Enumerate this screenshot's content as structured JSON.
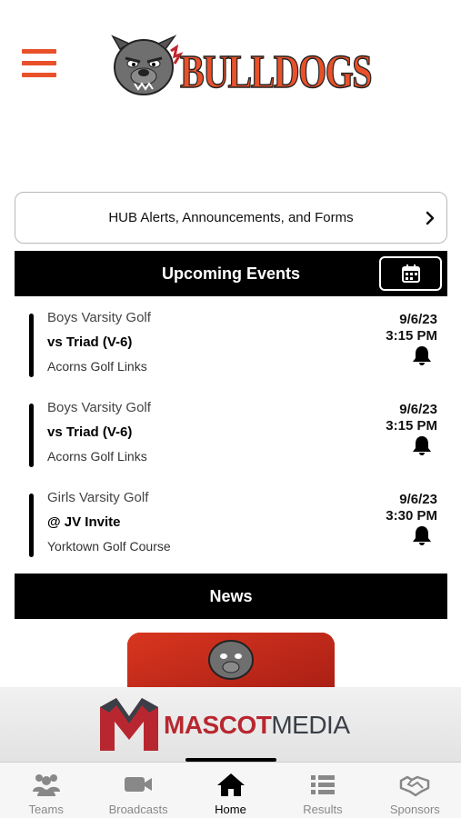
{
  "brand": {
    "accent": "#e8512a",
    "bar": "#000000"
  },
  "header": {
    "logo_text": "BULLDOGS",
    "menu_icon": "hamburger-menu-icon"
  },
  "hub": {
    "label": "HUB Alerts, Announcements, and Forms",
    "icon": "chevron-right-icon"
  },
  "upcoming": {
    "title": "Upcoming Events",
    "calendar_icon": "calendar-icon",
    "events": [
      {
        "team": "Boys Varsity Golf",
        "opponent": "vs Triad (V-6)",
        "venue": "Acorns Golf Links",
        "date": "9/6/23",
        "time": "3:15 PM"
      },
      {
        "team": "Boys Varsity Golf",
        "opponent": "vs Triad (V-6)",
        "venue": "Acorns Golf Links",
        "date": "9/6/23",
        "time": "3:15 PM"
      },
      {
        "team": "Girls Varsity Golf",
        "opponent": "@ JV Invite",
        "venue": "Yorktown Golf Course",
        "date": "9/6/23",
        "time": "3:30 PM"
      }
    ]
  },
  "news": {
    "title": "News"
  },
  "sponsor": {
    "brand_a": "MASCOT",
    "brand_b": "MEDIA"
  },
  "tabs": [
    {
      "label": "Teams",
      "icon": "teams-icon"
    },
    {
      "label": "Broadcasts",
      "icon": "video-camera-icon"
    },
    {
      "label": "Home",
      "icon": "home-icon",
      "active": true
    },
    {
      "label": "Results",
      "icon": "list-icon"
    },
    {
      "label": "Sponsors",
      "icon": "handshake-icon"
    }
  ]
}
